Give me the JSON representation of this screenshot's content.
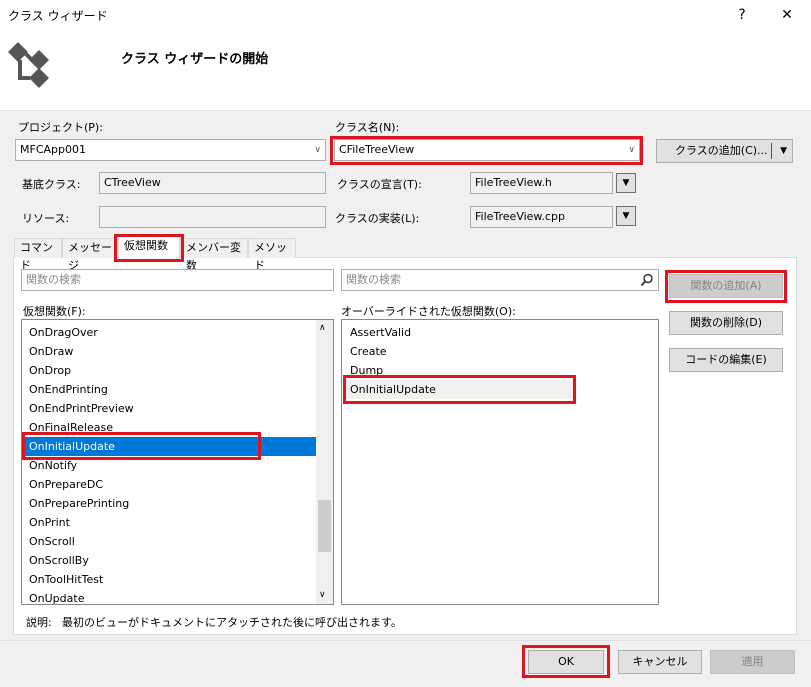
{
  "window": {
    "title": "クラス ウィザード",
    "help": "?",
    "close": "✕"
  },
  "header": {
    "title": "クラス ウィザードの開始"
  },
  "project": {
    "label": "プロジェクト(P):",
    "value": "MFCApp001"
  },
  "class_name": {
    "label": "クラス名(N):",
    "value": "CFileTreeView"
  },
  "add_class_button": {
    "label": "クラスの追加(C)..."
  },
  "base_class": {
    "label": "基底クラス:",
    "value": "CTreeView"
  },
  "class_declaration": {
    "label": "クラスの宣言(T):",
    "value": "FileTreeView.h"
  },
  "resource": {
    "label": "リソース:",
    "value": ""
  },
  "class_implementation": {
    "label": "クラスの実装(L):",
    "value": "FileTreeView.cpp"
  },
  "tabs": [
    {
      "label": "コマンド"
    },
    {
      "label": "メッセージ"
    },
    {
      "label": "仮想関数"
    },
    {
      "label": "メンバー変数"
    },
    {
      "label": "メソッド"
    }
  ],
  "left_search": {
    "placeholder": "関数の検索"
  },
  "right_search": {
    "placeholder": "関数の検索"
  },
  "virtual_functions": {
    "label": "仮想関数(F):",
    "items": [
      "OnDragOver",
      "OnDraw",
      "OnDrop",
      "OnEndPrinting",
      "OnEndPrintPreview",
      "OnFinalRelease",
      "OnInitialUpdate",
      "OnNotify",
      "OnPrepareDC",
      "OnPreparePrinting",
      "OnPrint",
      "OnScroll",
      "OnScrollBy",
      "OnToolHitTest",
      "OnUpdate"
    ],
    "selected": "OnInitialUpdate"
  },
  "overridden_functions": {
    "label": "オーバーライドされた仮想関数(O):",
    "items": [
      "AssertValid",
      "Create",
      "Dump",
      "OnInitialUpdate"
    ],
    "selected": "OnInitialUpdate"
  },
  "side_buttons": {
    "add_function": "関数の追加(A)",
    "delete_function": "関数の削除(D)",
    "edit_code": "コードの編集(E)"
  },
  "description": {
    "label": "説明:",
    "text": "最初のビューがドキュメントにアタッチされた後に呼び出されます。"
  },
  "footer": {
    "ok": "OK",
    "cancel": "キャンセル",
    "apply": "適用"
  },
  "colors": {
    "highlight": "#e0141e",
    "selection": "#0078d7"
  }
}
